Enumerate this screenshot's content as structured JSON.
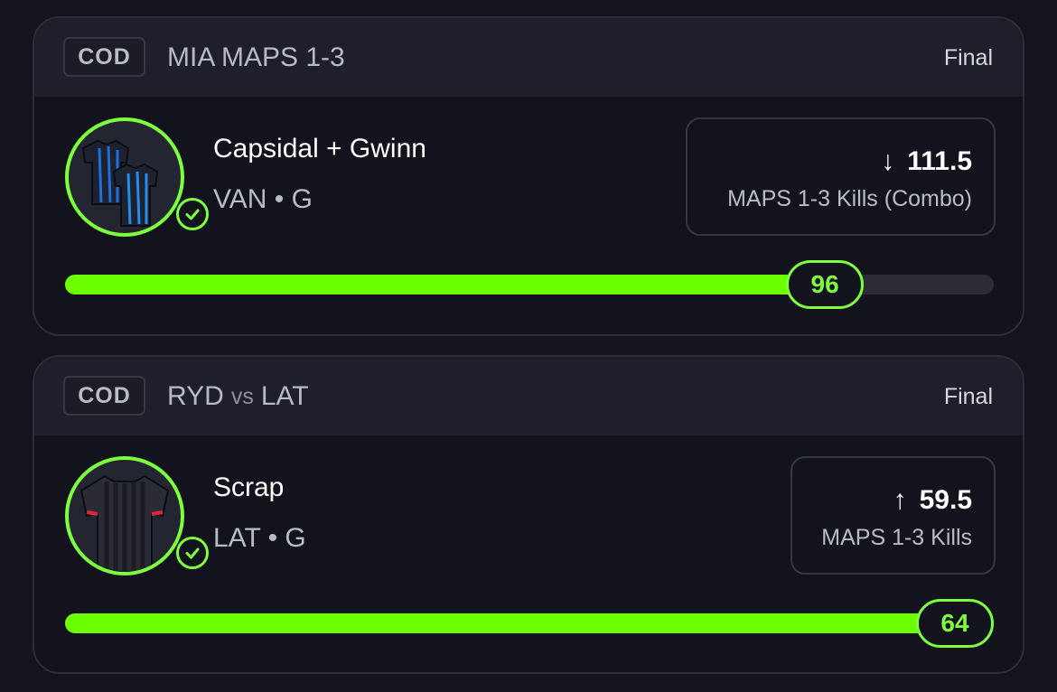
{
  "cards": [
    {
      "league": "COD",
      "match": {
        "team1": "MIA MAPS 1-3",
        "vs": "",
        "team2": ""
      },
      "status": "Final",
      "player": {
        "name": "Capsidal + Gwinn",
        "team": "VAN",
        "position": "G",
        "sub": "VAN • G"
      },
      "line": {
        "direction": "down",
        "arrow": "↓",
        "value": "111.5",
        "stat": "MAPS 1-3 Kills (Combo)"
      },
      "result": {
        "value": "96",
        "progress": 0.86
      },
      "avatar_icon": "jersey-pair-icon",
      "accent": "#6cff00"
    },
    {
      "league": "COD",
      "match": {
        "team1": "RYD",
        "vs": "vs",
        "team2": "LAT"
      },
      "status": "Final",
      "player": {
        "name": "Scrap",
        "team": "LAT",
        "position": "G",
        "sub": "LAT • G"
      },
      "line": {
        "direction": "up",
        "arrow": "↑",
        "value": "59.5",
        "stat": "MAPS 1-3 Kills"
      },
      "result": {
        "value": "64",
        "progress": 1.0
      },
      "avatar_icon": "jersey-icon",
      "accent": "#6cff00"
    }
  ]
}
